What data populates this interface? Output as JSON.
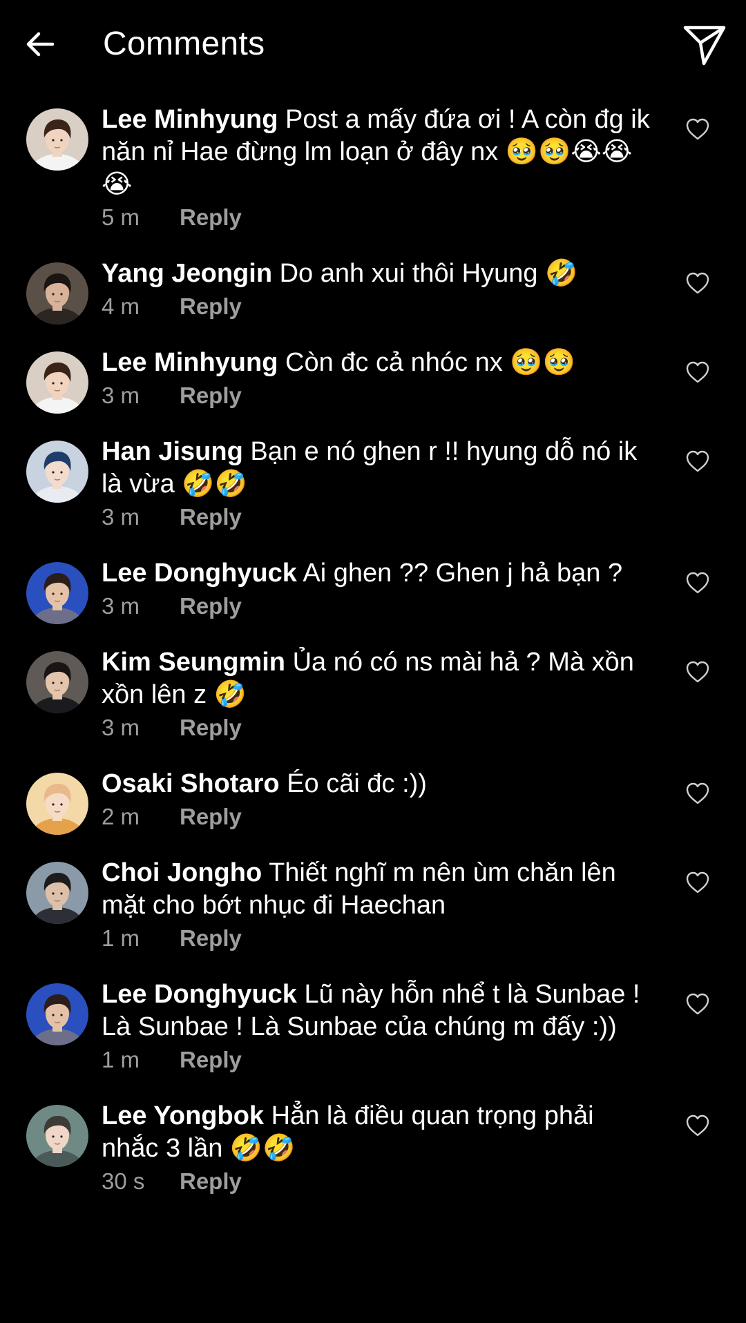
{
  "header": {
    "title": "Comments",
    "back_icon": "arrow-left-icon",
    "share_icon": "paper-plane-icon"
  },
  "reply_label": "Reply",
  "comments": [
    {
      "user": "Lee Minhyung",
      "text": "Post a mấy đứa ơi ! A còn đg ik năn nỉ Hae đừng lm loạn ở đây nx 🥹🥹😭😭😭",
      "time": "5 m",
      "avatar": {
        "bg": "#d9cfc4",
        "hair": "#3a2418",
        "skin": "#f1d4bf",
        "shirt": "#f4f4f4"
      }
    },
    {
      "user": "Yang Jeongin",
      "text": "Do anh xui thôi Hyung 🤣",
      "time": "4 m",
      "avatar": {
        "bg": "#5a5048",
        "hair": "#1c1410",
        "skin": "#d8b39a",
        "shirt": "#2b2622"
      }
    },
    {
      "user": "Lee Minhyung",
      "text": "Còn đc cả nhóc nx 🥹🥹",
      "time": "3 m",
      "avatar": {
        "bg": "#d9cfc4",
        "hair": "#3a2418",
        "skin": "#f1d4bf",
        "shirt": "#f4f4f4"
      }
    },
    {
      "user": "Han Jisung",
      "text": "Bạn e nó ghen r !! hyung dỗ nó ik là vừa 🤣🤣",
      "time": "3 m",
      "avatar": {
        "bg": "#c9d3df",
        "hair": "#1f3d6a",
        "skin": "#f3dccd",
        "shirt": "#e8ecf2"
      }
    },
    {
      "user": "Lee Donghyuck",
      "text": "Ai ghen ?? Ghen j hả bạn ?",
      "time": "3 m",
      "avatar": {
        "bg": "#2a4fbf",
        "hair": "#2b1e1a",
        "skin": "#e4c2a8",
        "shirt": "#6d6f8a"
      }
    },
    {
      "user": "Kim Seungmin",
      "text": "Ủa nó có ns mài hả ? Mà xồn xồn lên z 🤣",
      "time": "3 m",
      "avatar": {
        "bg": "#5f5a55",
        "hair": "#1a1414",
        "skin": "#e3c4ad",
        "shirt": "#1b1b1f"
      }
    },
    {
      "user": "Osaki Shotaro",
      "text": "Éo cãi đc :))",
      "time": "2 m",
      "avatar": {
        "bg": "#f4d9a8",
        "hair": "#e9b98b",
        "skin": "#f6dcc6",
        "shirt": "#e6a24a"
      }
    },
    {
      "user": "Choi Jongho",
      "text": "Thiết nghĩ m nên ùm chăn lên mặt cho bớt nhục đi Haechan",
      "time": "1 m",
      "avatar": {
        "bg": "#8a9aa8",
        "hair": "#1d1b1c",
        "skin": "#dcc0aa",
        "shirt": "#2e2f36"
      }
    },
    {
      "user": "Lee Donghyuck",
      "text": "Lũ này hỗn nhể t là Sunbae ! Là Sunbae ! Là Sunbae của chúng m đấy :))",
      "time": "1 m",
      "avatar": {
        "bg": "#2a4fbf",
        "hair": "#2b1e1a",
        "skin": "#e4c2a8",
        "shirt": "#6d6f8a"
      }
    },
    {
      "user": "Lee Yongbok",
      "text": "Hẳn là điều quan trọng phải nhắc 3 lần 🤣🤣",
      "time": "30 s",
      "avatar": {
        "bg": "#6f8a84",
        "hair": "#3e3a35",
        "skin": "#f0d6c6",
        "shirt": "#4a5a58"
      }
    }
  ]
}
